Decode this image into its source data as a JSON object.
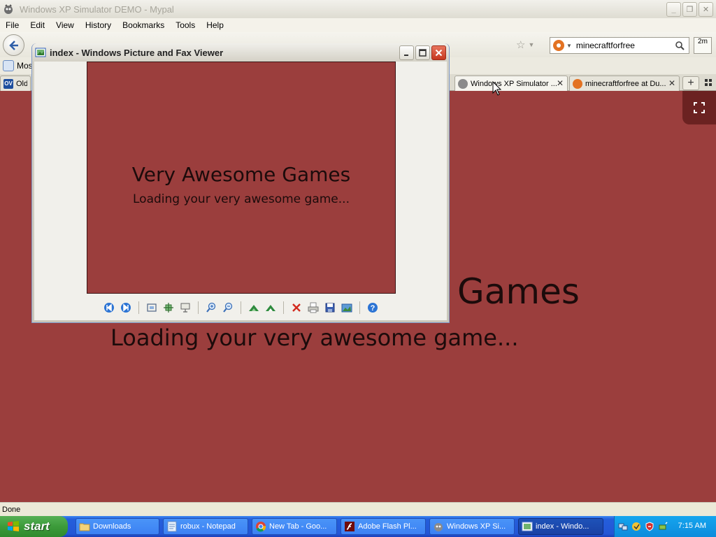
{
  "browser": {
    "window_title": "Windows XP Simulator DEMO - Mypal",
    "menu": [
      "File",
      "Edit",
      "View",
      "History",
      "Bookmarks",
      "Tools",
      "Help"
    ],
    "search": {
      "value": "minecraftforfree"
    },
    "addon_label": "2m",
    "bookmarks": [
      {
        "label": "Most"
      },
      {
        "label": "Old v"
      }
    ],
    "tabs": [
      {
        "label": "Windows XP Simulator ...",
        "active": true
      },
      {
        "label": "minecraftforfree at Du...",
        "active": false
      }
    ],
    "new_tab_label": "+",
    "status": "Done"
  },
  "page": {
    "title": "Games",
    "subtitle": "Loading your very awesome game...",
    "background_color": "#9B3E3D",
    "text_color": "#1C0B0B"
  },
  "viewer": {
    "title": "index - Windows Picture and Fax Viewer",
    "image": {
      "title": "Very Awesome Games",
      "subtitle": "Loading your very awesome game..."
    },
    "toolbar_icons": [
      "previous-image-icon",
      "next-image-icon",
      "best-fit-icon",
      "actual-size-icon",
      "slideshow-icon",
      "zoom-in-icon",
      "zoom-out-icon",
      "rotate-clockwise-icon",
      "rotate-counterclockwise-icon",
      "delete-icon",
      "print-icon",
      "save-icon",
      "edit-icon",
      "help-icon"
    ]
  },
  "taskbar": {
    "start_label": "start",
    "items": [
      {
        "label": "Downloads",
        "icon": "folder-icon",
        "active": false
      },
      {
        "label": "robux - Notepad",
        "icon": "notepad-icon",
        "active": false
      },
      {
        "label": "New Tab - Goo...",
        "icon": "chrome-icon",
        "active": false
      },
      {
        "label": "Adobe Flash Pl...",
        "icon": "flash-icon",
        "active": false
      },
      {
        "label": "Windows XP Si...",
        "icon": "mypal-icon",
        "active": false
      },
      {
        "label": "index - Windo...",
        "icon": "picture-viewer-icon",
        "active": true
      }
    ],
    "clock": "7:15 AM"
  }
}
